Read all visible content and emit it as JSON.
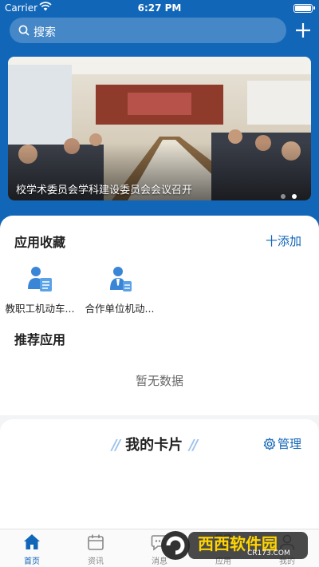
{
  "status_bar": {
    "carrier": "Carrier",
    "time": "6:27 PM"
  },
  "search": {
    "placeholder": "搜索"
  },
  "banner": {
    "caption": "校学术委员会学科建设委员会会议召开",
    "slide_count": 2,
    "active_slide": 2
  },
  "favorites": {
    "title": "应用收藏",
    "add_label": "十添加",
    "apps": [
      {
        "label": "教职工机动车...",
        "icon": "staff-vehicle-icon"
      },
      {
        "label": "合作单位机动...",
        "icon": "partner-vehicle-icon"
      }
    ]
  },
  "recommended": {
    "title": "推荐应用",
    "empty_text": "暂无数据"
  },
  "cards": {
    "title": "我的卡片",
    "manage_label": "管理"
  },
  "tabs": [
    {
      "label": "首页",
      "icon": "home-icon",
      "active": true
    },
    {
      "label": "资讯",
      "icon": "calendar-icon",
      "active": false
    },
    {
      "label": "消息",
      "icon": "message-icon",
      "active": false
    },
    {
      "label": "应用",
      "icon": "apps-icon",
      "active": false
    },
    {
      "label": "我的",
      "icon": "user-icon",
      "active": false
    }
  ],
  "watermark": {
    "brand": "西西软件园",
    "url": "CR173.COM"
  },
  "colors": {
    "primary": "#1266b8",
    "background": "#f3f4f6"
  }
}
